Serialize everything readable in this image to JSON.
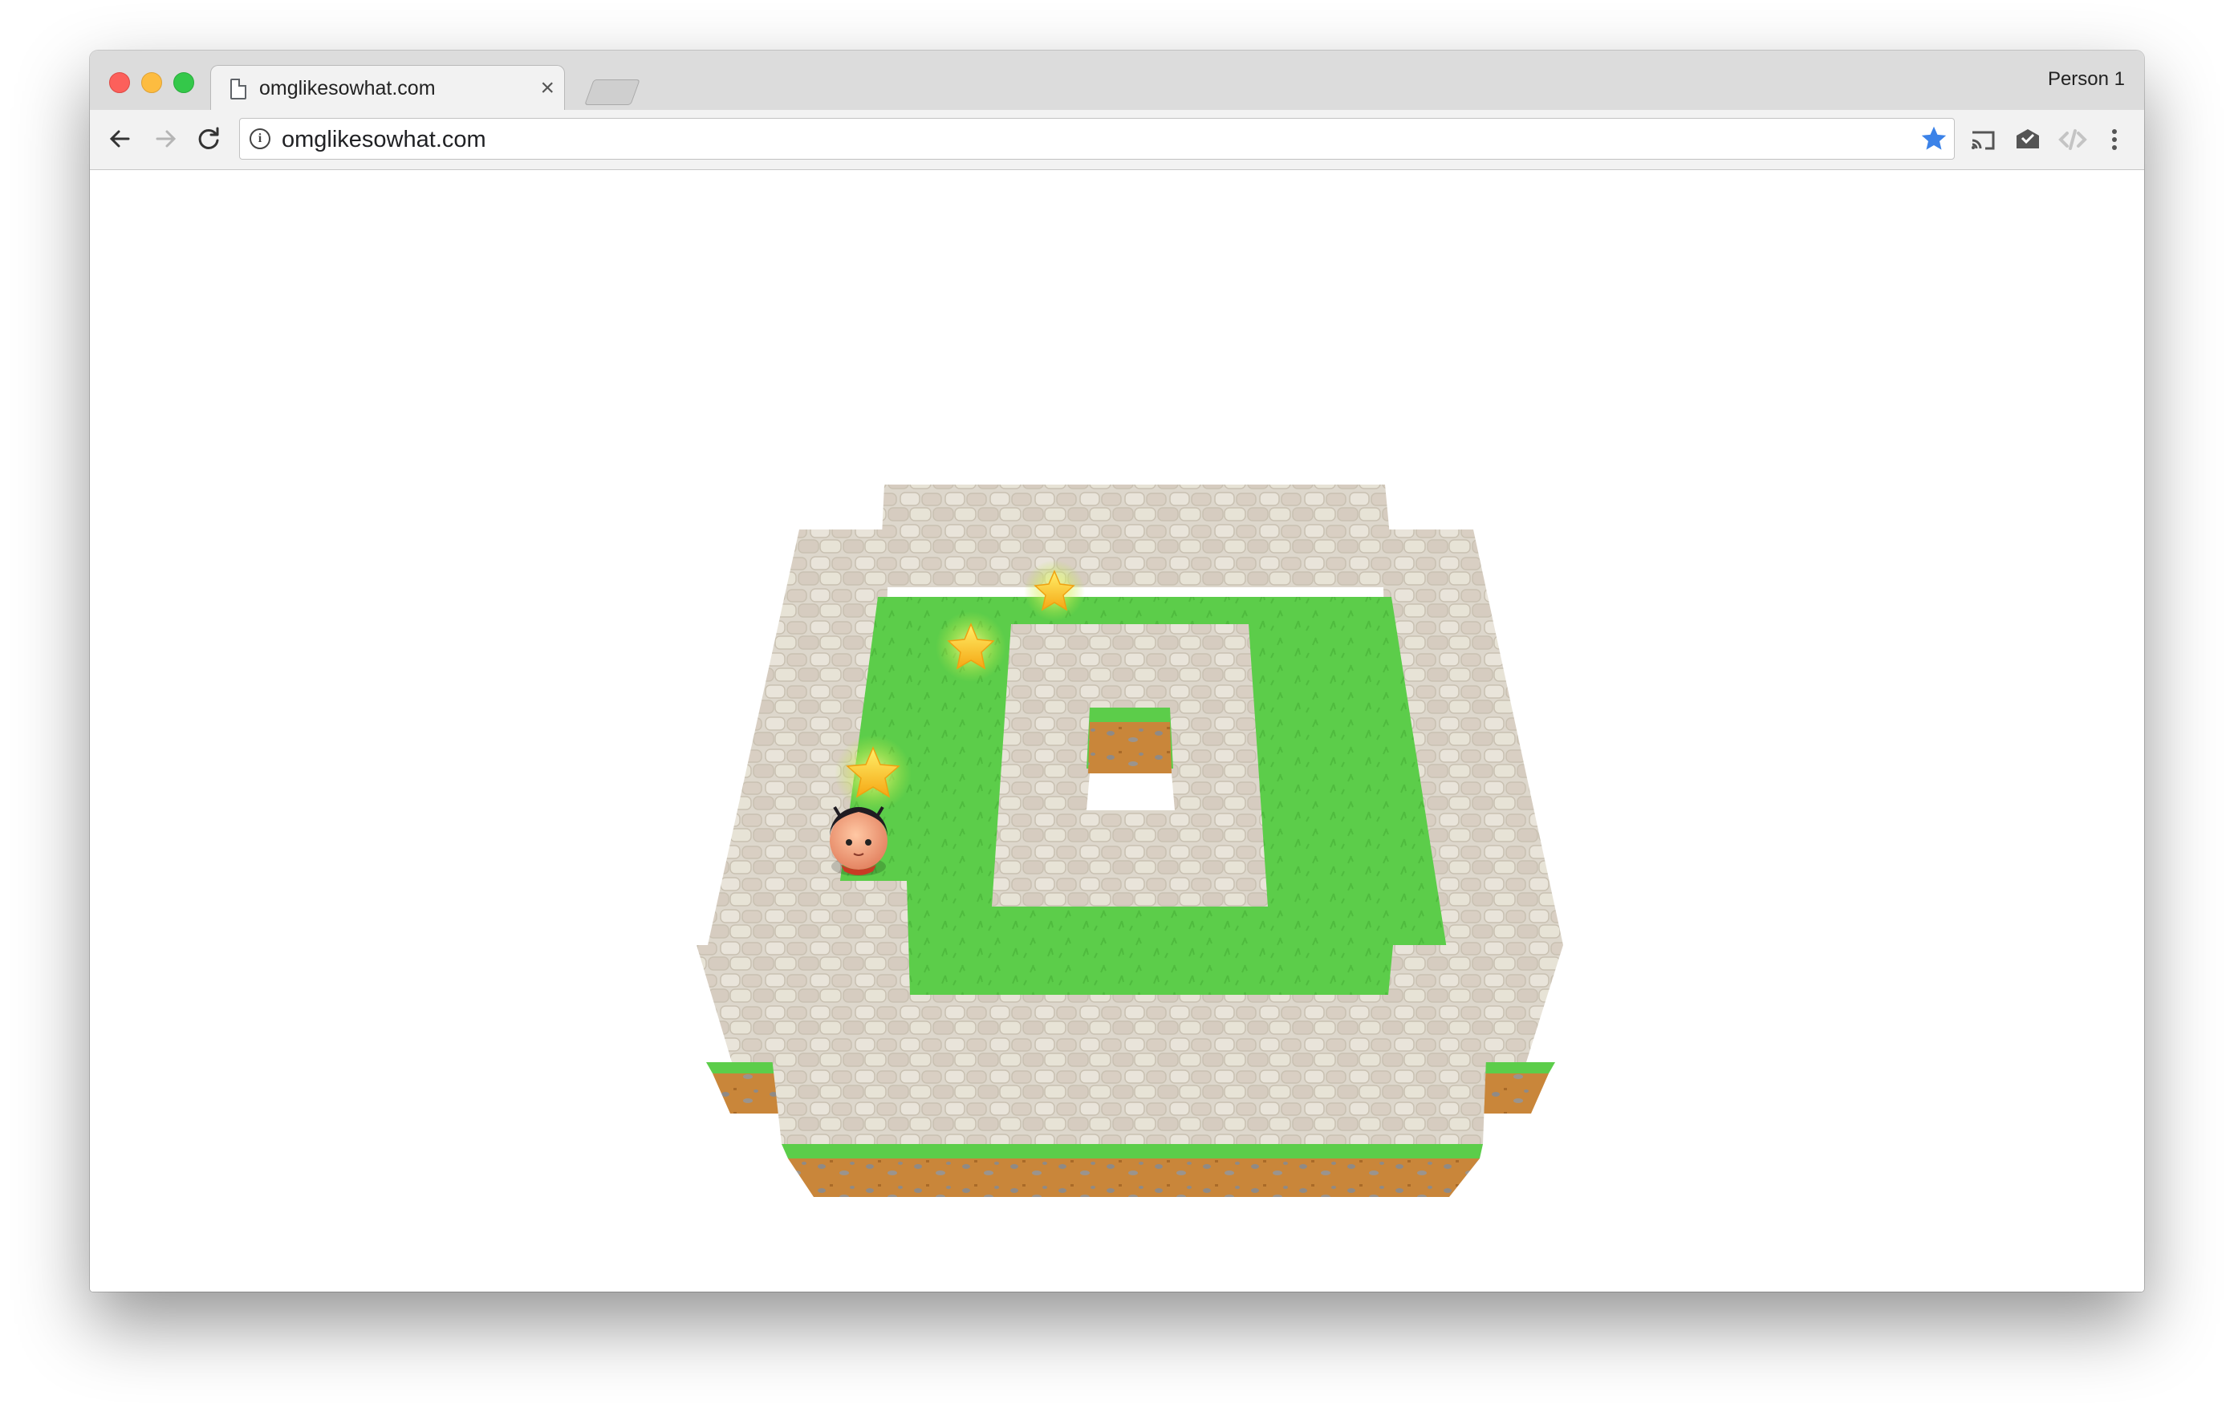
{
  "window": {
    "tab": {
      "title": "omglikesowhat.com",
      "close_label": "×"
    },
    "profile": "Person 1"
  },
  "toolbar": {
    "back_icon": "back-arrow-icon",
    "forward_icon": "forward-arrow-icon",
    "reload_icon": "reload-icon",
    "url": "omglikesowhat.com",
    "bookmarked": true,
    "extensions": [
      "cast-icon",
      "mail-check-icon",
      "code-extension-icon",
      "more-menu-icon"
    ]
  },
  "game": {
    "stars_visible": 3,
    "character": "player-avatar",
    "colors": {
      "grass": "#5ccd4a",
      "stone": "#dcd6cb",
      "dirt": "#c9863a",
      "star": "#ffd21a"
    }
  }
}
